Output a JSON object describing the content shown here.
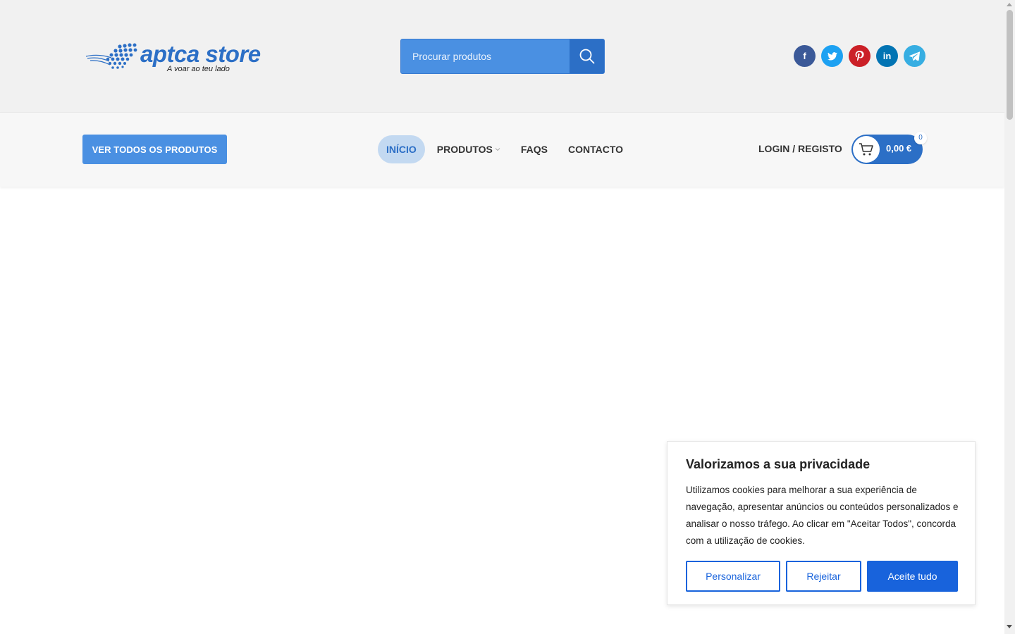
{
  "header": {
    "logo_name": "aptca store",
    "logo_tagline": "A voar ao teu lado",
    "search_placeholder": "Procurar produtos"
  },
  "socials": [
    {
      "name": "facebook",
      "glyph": "f",
      "color": "#3b5998"
    },
    {
      "name": "twitter",
      "glyph": "t",
      "color": "#1da1f2"
    },
    {
      "name": "pinterest",
      "glyph": "p",
      "color": "#cb2027"
    },
    {
      "name": "linkedin",
      "glyph": "in",
      "color": "#0274b3"
    },
    {
      "name": "telegram",
      "glyph": "➤",
      "color": "#37aee2"
    }
  ],
  "nav": {
    "all_products_label": "VER TODOS OS PRODUTOS",
    "items": [
      {
        "label": "INÍCIO",
        "active": true
      },
      {
        "label": "PRODUTOS",
        "active": false,
        "has_dropdown": true
      },
      {
        "label": "FAQS",
        "active": false
      },
      {
        "label": "CONTACTO",
        "active": false
      }
    ],
    "login_label": "LOGIN / REGISTO",
    "cart_amount": "0,00 €",
    "cart_count": "0"
  },
  "cookie_banner": {
    "title": "Valorizamos a sua privacidade",
    "body": "Utilizamos cookies para melhorar a sua experiência de navegação, apresentar anúncios ou conteúdos personalizados e analisar o nosso tráfego. Ao clicar em \"Aceitar Todos\", concorda com a utilização de cookies.",
    "customize_label": "Personalizar",
    "reject_label": "Rejeitar",
    "accept_label": "Aceite tudo"
  },
  "colors": {
    "brand_blue": "#2c6fc6",
    "button_blue": "#4a90e2",
    "cookie_blue": "#1863dc"
  }
}
